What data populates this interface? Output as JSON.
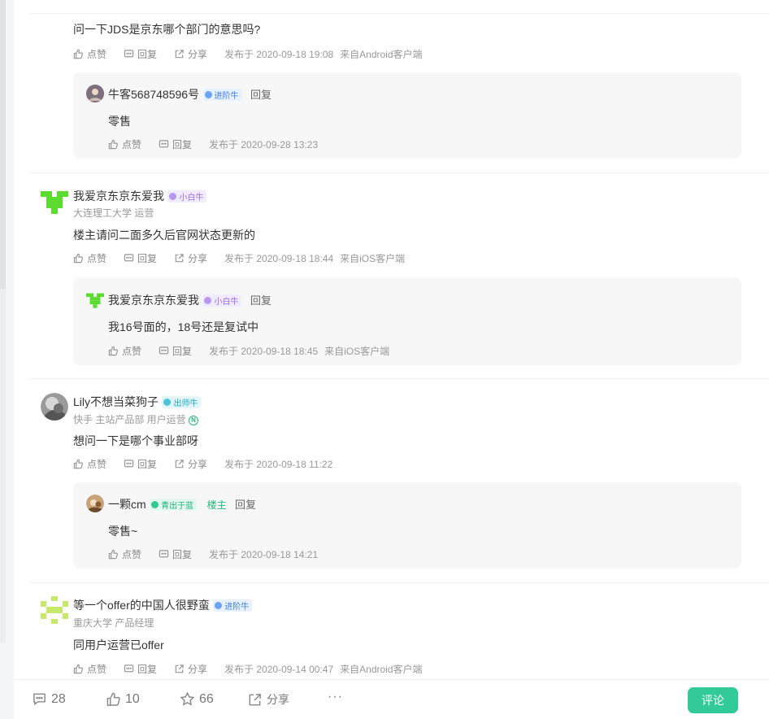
{
  "common": {
    "like": "点赞",
    "reply": "回复",
    "share": "分享"
  },
  "thread0": {
    "content": "问一下JDS是京东哪个部门的意思吗?",
    "meta": "发布于 2020-09-18 19:08",
    "source": "来自Android客户端",
    "reply": {
      "name": "牛客568748596号",
      "badge": "进阶牛",
      "content": "零售",
      "meta": "发布于 2020-09-28 13:23"
    }
  },
  "thread1": {
    "name": "我爱京东京东爱我",
    "badge": "小白牛",
    "sub": "大连理工大学 运营",
    "content": "楼主请问二面多久后官网状态更新的",
    "meta": "发布于 2020-09-18 18:44",
    "source": "来自iOS客户端",
    "reply": {
      "name": "我爱京东京东爱我",
      "badge": "小白牛",
      "content": "我16号面的，18号还是复试中",
      "meta": "发布于 2020-09-18 18:45",
      "source": "来自iOS客户端"
    }
  },
  "thread2": {
    "name": "Lily不想当菜狗子",
    "badge": "出师牛",
    "sub": "快手 主站产品部 用户运营",
    "sub_badge": "N",
    "content": "想问一下是哪个事业部呀",
    "meta": "发布于 2020-09-18 11:22",
    "reply": {
      "name": "一颗cm",
      "badge": "青出于蓝",
      "owner": "楼主",
      "content": "零售~",
      "meta": "发布于 2020-09-18 14:21"
    }
  },
  "thread3": {
    "name": "等一个offer的中国人很野蛮",
    "badge": "进阶牛",
    "sub": "重庆大学 产品经理",
    "content": "同用户运营已offer",
    "meta": "发布于 2020-09-14 00:47",
    "source": "来自Android客户端"
  },
  "bottom": {
    "comments": "28",
    "likes": "10",
    "favorites": "66",
    "share": "分享",
    "more": "···",
    "comment_button": "评论"
  },
  "colors": {
    "accent": "#32ca99",
    "avatar_green": "#5bdc2f",
    "avatar_lime": "#c7e86b"
  }
}
